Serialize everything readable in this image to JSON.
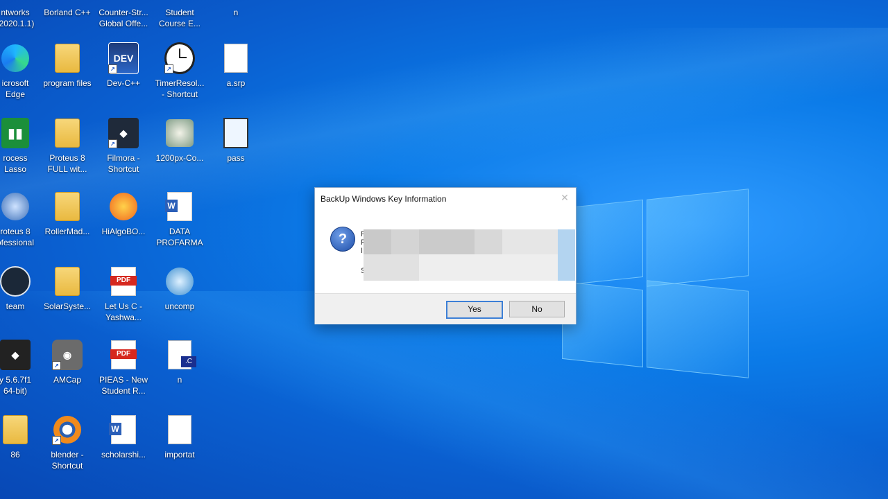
{
  "desktop": {
    "icons": [
      {
        "label": "ntworks\n(2020.1.1)",
        "icon": "app-icon"
      },
      {
        "label": "Borland C++",
        "icon": "app-icon"
      },
      {
        "label": "Counter-Str...\nGlobal Offe...",
        "icon": "game-icon"
      },
      {
        "label": "Student\nCourse E...",
        "icon": "doc-icon"
      },
      {
        "label": "n",
        "icon": "doc-icon"
      },
      {
        "label": "icrosoft\nEdge",
        "icon": "edge-icon"
      },
      {
        "label": "program files",
        "icon": "folder-icon"
      },
      {
        "label": "Dev-C++",
        "icon": "devcpp-icon"
      },
      {
        "label": "TimerResol...\n- Shortcut",
        "icon": "clock-icon"
      },
      {
        "label": "a.srp",
        "icon": "file-icon"
      },
      {
        "label": "rocess\nLasso",
        "icon": "process-lasso-icon"
      },
      {
        "label": "Proteus 8\nFULL wit...",
        "icon": "folder-icon"
      },
      {
        "label": "Filmora -\nShortcut",
        "icon": "filmora-icon"
      },
      {
        "label": "1200px-Co...",
        "icon": "image-icon"
      },
      {
        "label": "pass",
        "icon": "script-icon"
      },
      {
        "label": "roteus 8\nofessional",
        "icon": "proteus-icon"
      },
      {
        "label": "RollerMad...",
        "icon": "folder-icon"
      },
      {
        "label": "HiAlgoBO...",
        "icon": "hialgo-icon"
      },
      {
        "label": "DATA\nPROFARMA",
        "icon": "word-icon"
      },
      {
        "label": "team",
        "icon": "steam-icon"
      },
      {
        "label": "SolarSyste...",
        "icon": "folder-icon"
      },
      {
        "label": "Let Us C -\nYashwa...",
        "icon": "pdf-icon"
      },
      {
        "label": "uncomp",
        "icon": "atom-icon"
      },
      {
        "label": "y 5.6.7f1\n64-bit)",
        "icon": "unity-icon"
      },
      {
        "label": "AMCap",
        "icon": "camera-icon"
      },
      {
        "label": "PIEAS - New\nStudent R...",
        "icon": "pdf-icon"
      },
      {
        "label": "n",
        "icon": "c-file-icon"
      },
      {
        "label": "86",
        "icon": "folder-icon"
      },
      {
        "label": "blender -\nShortcut",
        "icon": "blender-icon"
      },
      {
        "label": "scholarshi...",
        "icon": "word-icon"
      },
      {
        "label": "importat",
        "icon": "doc-icon"
      }
    ]
  },
  "dialog": {
    "title": "BackUp Windows Key Information",
    "close_label": "✕",
    "icon": "question-icon",
    "icon_glyph": "?",
    "text_fragments": [
      "F",
      "F",
      "I",
      "S"
    ],
    "yes_label": "Yes",
    "no_label": "No"
  },
  "colors": {
    "desktop_bg": "#0a6ee0",
    "dialog_footer": "#f0f0f0",
    "button_focus": "#3c7fd6"
  }
}
